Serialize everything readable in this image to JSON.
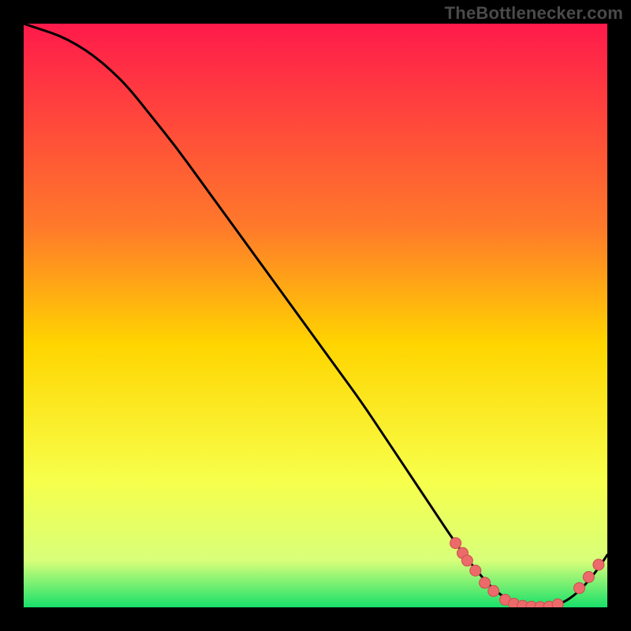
{
  "watermark": "TheBottlenecker.com",
  "colors": {
    "gradient_top": "#ff1a4b",
    "gradient_mid_upper": "#ff7a2a",
    "gradient_mid": "#ffd500",
    "gradient_mid_lower": "#f7ff4a",
    "gradient_lower": "#d8ff7a",
    "gradient_bottom": "#18e06a",
    "curve": "#000000",
    "dot_fill": "#ed6a6a",
    "dot_stroke": "#c84f4f"
  },
  "chart_data": {
    "type": "line",
    "xlabel": "",
    "ylabel": "",
    "xlim": [
      0,
      100
    ],
    "ylim": [
      0,
      100
    ],
    "grid": false,
    "legend": false,
    "series": [
      {
        "name": "bottleneck-curve",
        "x": [
          0,
          3,
          6,
          9,
          12,
          15,
          18,
          22,
          26,
          30,
          34,
          38,
          42,
          46,
          50,
          54,
          58,
          62,
          66,
          70,
          74,
          77,
          80,
          83,
          86,
          89,
          92,
          95,
          98,
          100
        ],
        "y": [
          100,
          99,
          98,
          96.5,
          94.5,
          92,
          89,
          84,
          79,
          73.5,
          68,
          62.5,
          57,
          51.5,
          46,
          40.5,
          35,
          29,
          23,
          17,
          11,
          7,
          3.5,
          1.2,
          0.2,
          0,
          0.5,
          2.5,
          6,
          9
        ]
      }
    ],
    "dots": [
      {
        "x": 74,
        "y": 11
      },
      {
        "x": 75.2,
        "y": 9.3
      },
      {
        "x": 76,
        "y": 8
      },
      {
        "x": 77.4,
        "y": 6.3
      },
      {
        "x": 79,
        "y": 4.2
      },
      {
        "x": 80.5,
        "y": 2.8
      },
      {
        "x": 82.5,
        "y": 1.3
      },
      {
        "x": 84,
        "y": 0.6
      },
      {
        "x": 85.5,
        "y": 0.25
      },
      {
        "x": 87,
        "y": 0.1
      },
      {
        "x": 88.5,
        "y": 0.05
      },
      {
        "x": 90,
        "y": 0.1
      },
      {
        "x": 91.5,
        "y": 0.5
      },
      {
        "x": 95.2,
        "y": 3.3
      },
      {
        "x": 96.8,
        "y": 5.2
      },
      {
        "x": 98.5,
        "y": 7.3
      }
    ]
  }
}
